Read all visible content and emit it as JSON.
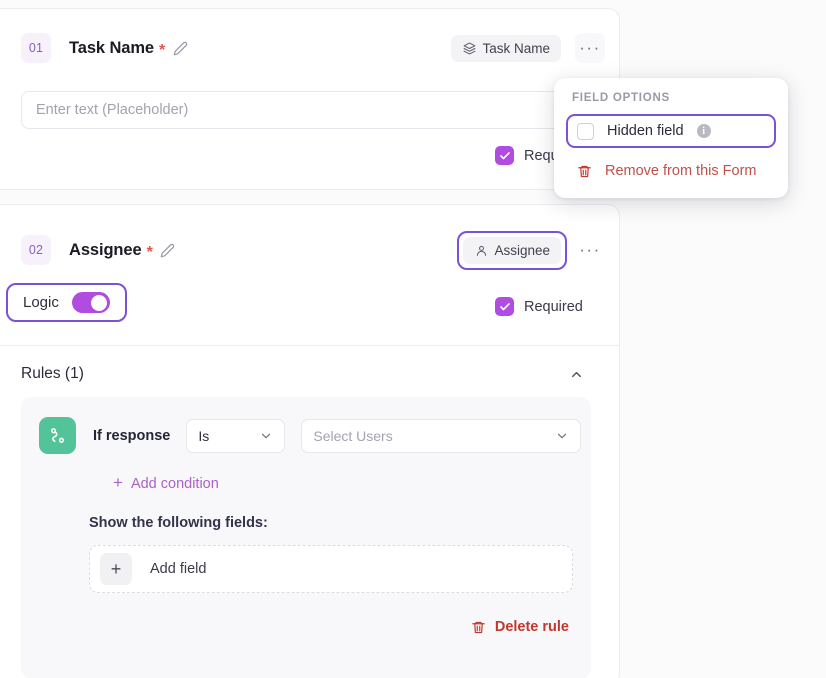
{
  "fields": [
    {
      "number": "01",
      "title": "Task Name",
      "required_star": "*",
      "type_chip": "Task Name",
      "type_icon": "layers-icon",
      "input_placeholder": "Enter text (Placeholder)",
      "required_label": "Required"
    },
    {
      "number": "02",
      "title": "Assignee",
      "required_star": "*",
      "type_chip": "Assignee",
      "type_icon": "person-icon",
      "required_label": "Required",
      "logic_label": "Logic"
    }
  ],
  "rules": {
    "header": "Rules (1)",
    "collapse_icon": "chevron-up-icon",
    "rule": {
      "icon": "branch-icon",
      "if_label": "If response",
      "operator_value": "Is",
      "operator_icon": "chevron-down-icon",
      "users_placeholder": "Select Users",
      "users_icon": "chevron-down-icon",
      "add_condition": "Add condition",
      "add_condition_icon": "plus-icon",
      "show_fields_label": "Show the following fields:",
      "add_field_label": "Add field",
      "add_field_icon": "plus-icon",
      "delete_rule": "Delete rule",
      "delete_rule_icon": "trash-icon"
    }
  },
  "popup": {
    "title": "FIELD OPTIONS",
    "hidden_field_label": "Hidden field",
    "hidden_field_checked": false,
    "info_icon": "info-icon",
    "info_glyph": "i",
    "remove_label": "Remove from this Form",
    "remove_icon": "trash-icon"
  },
  "icons": {
    "dots": "···",
    "plus": "+"
  },
  "colors": {
    "accent_purple": "#7b52d6",
    "toggle_purple": "#b04ce0",
    "badge_purple": "#8b5ec4",
    "danger_red": "#c0392f",
    "rule_green": "#53c49a",
    "star_red": "#e8534f"
  }
}
